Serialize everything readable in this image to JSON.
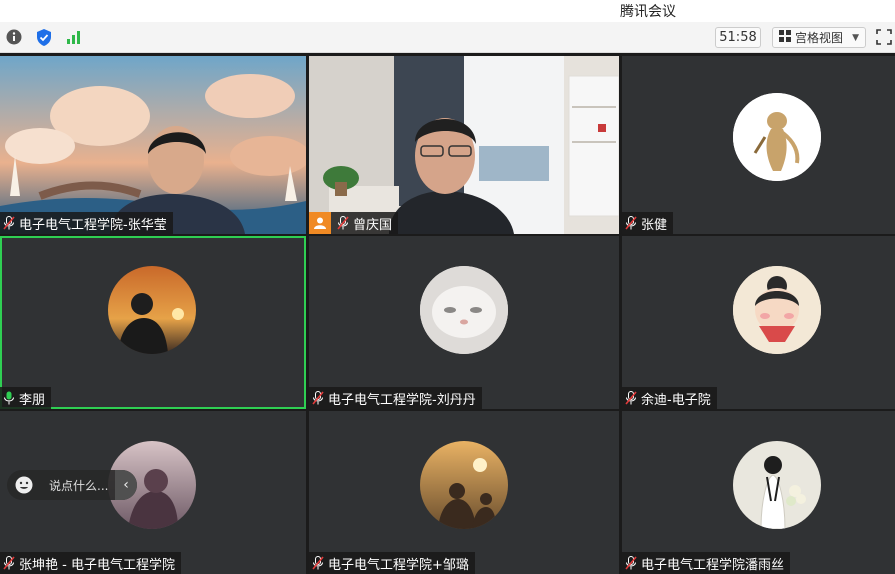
{
  "app": {
    "title": "腾讯会议"
  },
  "toolbar": {
    "timer": "51:58",
    "view_label": "宫格视图",
    "icons": [
      "info-icon",
      "shield-icon",
      "signal-icon",
      "grid-view-icon",
      "fullscreen-icon"
    ]
  },
  "participants": [
    {
      "name": "电子电气工程学院-张华莹",
      "mic": "muted"
    },
    {
      "name": "曾庆国",
      "mic": "muted",
      "host": true
    },
    {
      "name": "张健",
      "mic": "muted"
    },
    {
      "name": "李朋",
      "mic": "active",
      "speaking": true
    },
    {
      "name": "电子电气工程学院-刘丹丹",
      "mic": "muted"
    },
    {
      "name": "余迪-电子院",
      "mic": "muted"
    },
    {
      "name": "张坤艳 - 电子电气工程学院",
      "mic": "muted"
    },
    {
      "name": "电子电气工程学院+邹璐",
      "mic": "muted"
    },
    {
      "name": "电子电气工程学院潘雨丝",
      "mic": "muted"
    }
  ],
  "chat": {
    "placeholder": "说点什么..."
  },
  "colors": {
    "speaking_border": "#2fcf53",
    "host_badge": "#f08a24",
    "tile_bg": "#303234"
  }
}
